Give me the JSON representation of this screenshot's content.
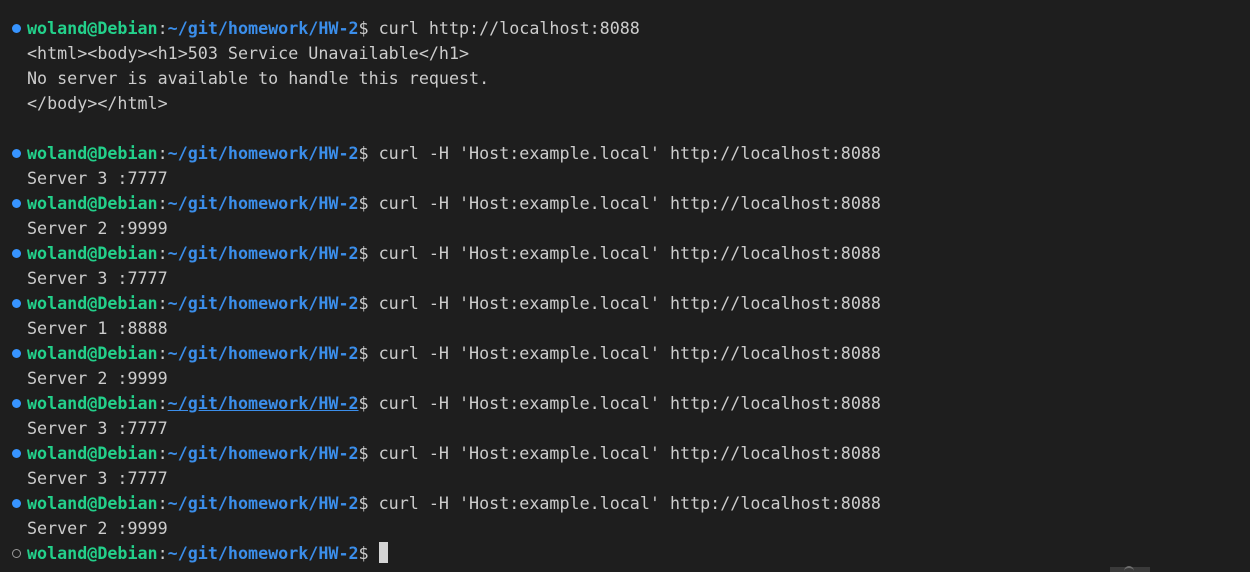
{
  "prompt": {
    "user": "woland@Debian",
    "path": "~/git/homework/HW-2",
    "symbol": "$ "
  },
  "lines": [
    {
      "kind": "prompt",
      "decoration": "filled",
      "command": "curl http://localhost:8088"
    },
    {
      "kind": "output",
      "text": "<html><body><h1>503 Service Unavailable</h1>"
    },
    {
      "kind": "output",
      "text": "No server is available to handle this request."
    },
    {
      "kind": "output",
      "text": "</body></html>"
    },
    {
      "kind": "output",
      "text": ""
    },
    {
      "kind": "prompt",
      "decoration": "filled",
      "command": "curl -H 'Host:example.local' http://localhost:8088"
    },
    {
      "kind": "output",
      "text": "Server 3 :7777"
    },
    {
      "kind": "prompt",
      "decoration": "filled",
      "command": "curl -H 'Host:example.local' http://localhost:8088"
    },
    {
      "kind": "output",
      "text": "Server 2 :9999"
    },
    {
      "kind": "prompt",
      "decoration": "filled",
      "command": "curl -H 'Host:example.local' http://localhost:8088"
    },
    {
      "kind": "output",
      "text": "Server 3 :7777"
    },
    {
      "kind": "prompt",
      "decoration": "filled",
      "command": "curl -H 'Host:example.local' http://localhost:8088"
    },
    {
      "kind": "output",
      "text": "Server 1 :8888"
    },
    {
      "kind": "prompt",
      "decoration": "filled",
      "command": "curl -H 'Host:example.local' http://localhost:8088"
    },
    {
      "kind": "output",
      "text": "Server 2 :9999"
    },
    {
      "kind": "prompt",
      "decoration": "filled",
      "command": "curl -H 'Host:example.local' http://localhost:8088",
      "path_link": true
    },
    {
      "kind": "output",
      "text": "Server 3 :7777"
    },
    {
      "kind": "prompt",
      "decoration": "filled",
      "command": "curl -H 'Host:example.local' http://localhost:8088"
    },
    {
      "kind": "output",
      "text": "Server 3 :7777"
    },
    {
      "kind": "prompt",
      "decoration": "filled",
      "command": "curl -H 'Host:example.local' http://localhost:8088"
    },
    {
      "kind": "output",
      "text": "Server 2 :9999"
    },
    {
      "kind": "prompt",
      "decoration": "hollow",
      "command": "",
      "cursor": true
    }
  ],
  "colors": {
    "background": "#1e1e1e",
    "user": "#23d18b",
    "path": "#3b8eea",
    "text": "#cccccc",
    "decoration_success": "#3794ff"
  }
}
